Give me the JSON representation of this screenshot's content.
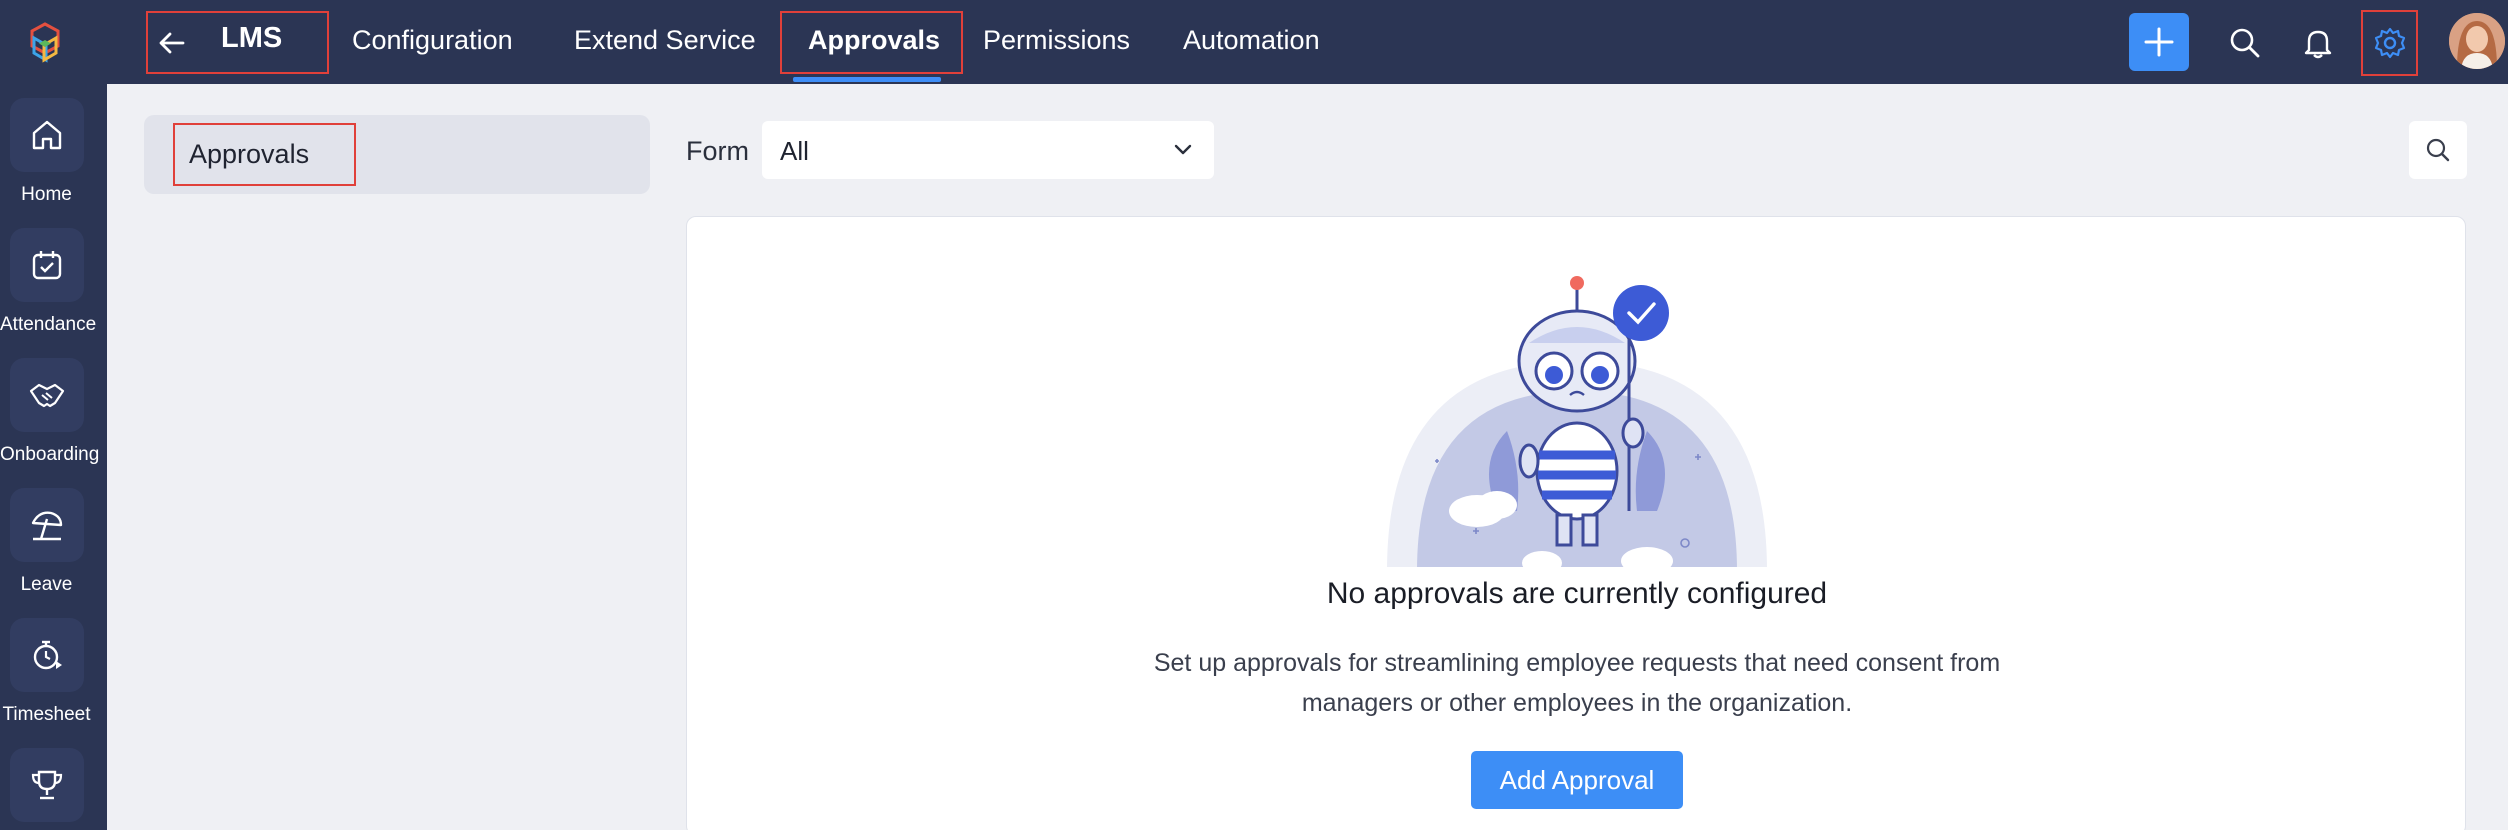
{
  "rail": {
    "items": [
      {
        "label": "Home",
        "icon": "home-icon"
      },
      {
        "label": "Attendance",
        "icon": "calendar-check-icon"
      },
      {
        "label": "Onboarding",
        "icon": "handshake-icon"
      },
      {
        "label": "Leave",
        "icon": "beach-umbrella-icon"
      },
      {
        "label": "Timesheet",
        "icon": "stopwatch-icon"
      },
      {
        "label": "",
        "icon": "trophy-icon"
      }
    ]
  },
  "topbar": {
    "app_name": "LMS",
    "tabs": [
      {
        "label": "Configuration"
      },
      {
        "label": "Extend Service"
      },
      {
        "label": "Approvals",
        "active": true
      },
      {
        "label": "Permissions"
      },
      {
        "label": "Automation"
      }
    ]
  },
  "sidebar": {
    "items": [
      {
        "label": "Approvals",
        "selected": true
      }
    ]
  },
  "filter": {
    "label": "Form",
    "selected": "All"
  },
  "empty_state": {
    "title": "No approvals are currently configured",
    "description": "Set up approvals for streamlining employee requests that need consent from managers or other employees in the organization.",
    "button_label": "Add Approval"
  },
  "colors": {
    "nav_bg": "#2b3554",
    "accent": "#3d8ef6",
    "highlight_border": "#e0403a",
    "page_bg": "#eff0f4"
  }
}
